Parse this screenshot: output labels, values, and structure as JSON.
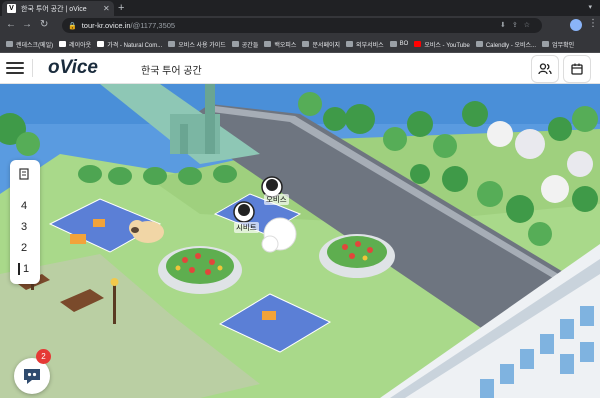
{
  "browser": {
    "tab_title": "한국 투어 공간 | oVice",
    "tab_favicon": "V",
    "url_host": "tour-kr.ovice.in",
    "url_path": "/@1177,3505"
  },
  "bookmarks": [
    {
      "label": "렌데스크(메일)",
      "icon": "folder"
    },
    {
      "label": "레이아웃",
      "icon": "v"
    },
    {
      "label": "가격 - Natural Com...",
      "icon": "v"
    },
    {
      "label": "오비스 사용 가이드",
      "icon": "folder"
    },
    {
      "label": "공간들",
      "icon": "folder"
    },
    {
      "label": "백오피스",
      "icon": "folder"
    },
    {
      "label": "문서페이지",
      "icon": "folder"
    },
    {
      "label": "외부서비스",
      "icon": "folder"
    },
    {
      "label": "BO",
      "icon": "folder"
    },
    {
      "label": "오비스 - YouTube",
      "icon": "yt"
    },
    {
      "label": "Calendly - 오비스...",
      "icon": "folder"
    },
    {
      "label": "업무확인",
      "icon": "folder"
    }
  ],
  "app": {
    "logo": "oVice",
    "space_name": "한국 투어 공간"
  },
  "floors": {
    "items": [
      "4",
      "3",
      "2",
      "1"
    ],
    "active": "1"
  },
  "avatars": [
    {
      "name": "오비스"
    },
    {
      "name": "시비트"
    }
  ],
  "chat": {
    "badge_count": "2"
  },
  "colors": {
    "grass": "#a9d98a",
    "water": "#4a8fd8",
    "road": "#6e7580",
    "blanket": "#5b7fd6"
  }
}
